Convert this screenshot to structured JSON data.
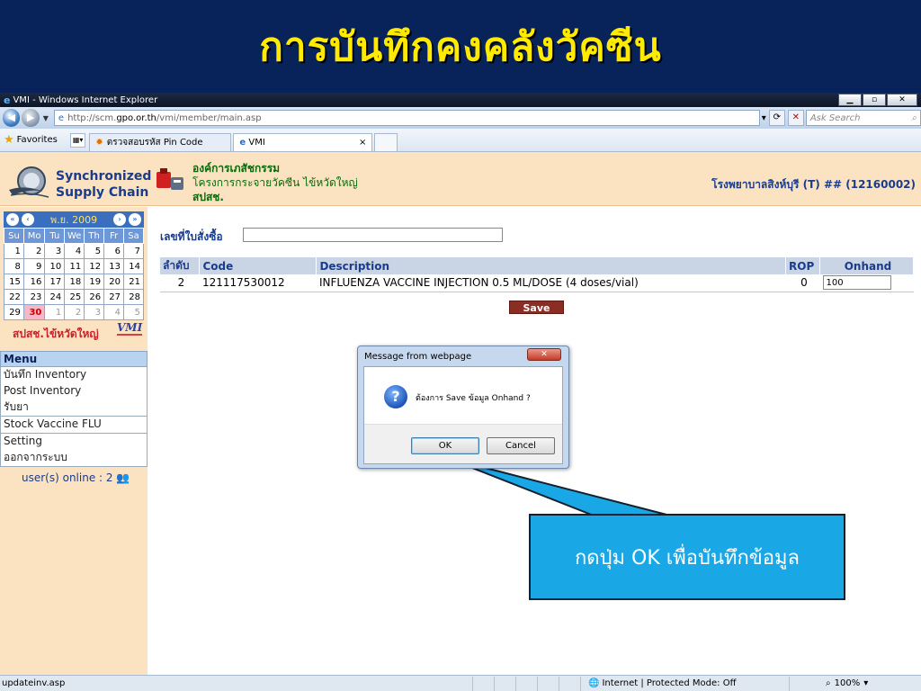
{
  "slide": {
    "title": "การบันทึกคงคลังวัคซีน"
  },
  "browser": {
    "window_title": "VMI - Windows Internet Explorer",
    "controls": {
      "minimize": "▁",
      "maximize": "▫",
      "close": "✕"
    },
    "address": {
      "prefix": "http://scm.",
      "domain": "gpo.or.th",
      "path": "/vmi/member/main.asp"
    },
    "search_placeholder": "Ask Search",
    "favorites_label": "Favorites",
    "tabs": [
      {
        "label": "ตรวจสอบรหัส Pin Code"
      },
      {
        "label": "VMI",
        "close": "×"
      }
    ],
    "status": {
      "url": "updateinv.asp",
      "zone": "Internet | Protected Mode: Off",
      "zoom": "100%"
    }
  },
  "header": {
    "logo_line1": "Synchronized",
    "logo_line2": "Supply Chain",
    "org_line1": "องค์การเภสัชกรรม",
    "org_line2": "โครงการกระจายวัคซีน ไข้หวัดใหญ่",
    "org_line3": "สปสช.",
    "hospital": "โรงพยาบาลสิงห์บุรี (T) ## (12160002)"
  },
  "calendar": {
    "month": "พ.ย. 2009",
    "weekdays": [
      "Su",
      "Mo",
      "Tu",
      "We",
      "Th",
      "Fr",
      "Sa"
    ],
    "weeks": [
      [
        "1",
        "2",
        "3",
        "4",
        "5",
        "6",
        "7"
      ],
      [
        "8",
        "9",
        "10",
        "11",
        "12",
        "13",
        "14"
      ],
      [
        "15",
        "16",
        "17",
        "18",
        "19",
        "20",
        "21"
      ],
      [
        "22",
        "23",
        "24",
        "25",
        "26",
        "27",
        "28"
      ],
      [
        "29",
        "30",
        "1",
        "2",
        "3",
        "4",
        "5"
      ]
    ],
    "today": "30"
  },
  "sidebar": {
    "district_label": "สปสช.ไข้หวัดใหญ่",
    "vmi_mark": "VMI",
    "menu_title": "Menu",
    "menu_groups": [
      [
        "บันทึก Inventory",
        "Post Inventory",
        "รับยา"
      ],
      [
        "Stock Vaccine FLU"
      ],
      [
        "Setting",
        "ออกจากระบบ"
      ]
    ],
    "online": "user(s) online : 2"
  },
  "form": {
    "po_label": "เลขที่ใบสั่งซื้อ",
    "po_value": "",
    "columns": [
      "ลำดับ",
      "Code",
      "Description",
      "ROP",
      "Onhand"
    ],
    "rows": [
      {
        "no": "2",
        "code": "121117530012",
        "description": "INFLUENZA VACCINE INJECTION 0.5 ML/DOSE (4 doses/vial)",
        "rop": "0",
        "onhand": "100"
      }
    ],
    "save_label": "Save"
  },
  "dialog": {
    "title": "Message from webpage",
    "message": "ต้องการ Save ข้อมูล Onhand ?",
    "ok": "OK",
    "cancel": "Cancel"
  },
  "callout": {
    "text": "กดปุ่ม OK เพื่อบันทึกข้อมูล"
  }
}
